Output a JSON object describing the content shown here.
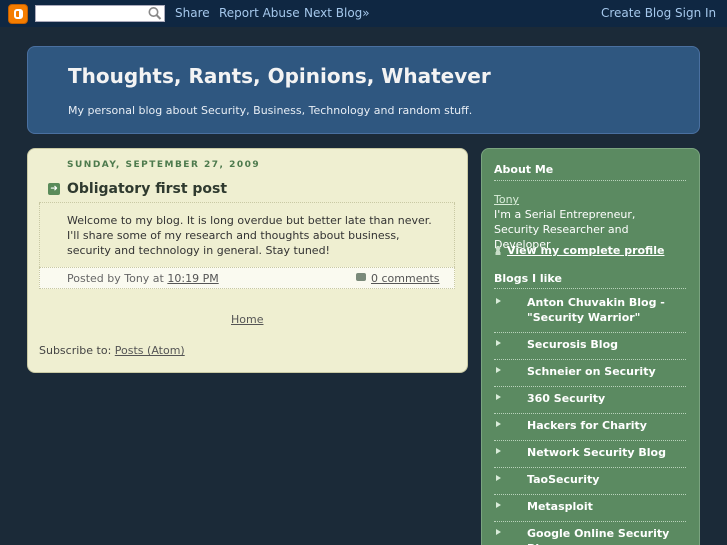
{
  "navbar": {
    "share": "Share",
    "report_abuse": "Report Abuse",
    "next_blog": "Next Blog»",
    "create_blog": "Create Blog",
    "sign_in": "Sign In",
    "search_placeholder": ""
  },
  "header": {
    "title": "Thoughts, Rants, Opinions, Whatever",
    "description": "My personal blog about Security, Business, Technology and random stuff."
  },
  "post": {
    "date": "SUNDAY, SEPTEMBER 27, 2009",
    "title": "Obligatory first post",
    "body": "Welcome to my blog. It is long overdue but better late than never. I'll share some of my research and thoughts about business, security and technology in general. Stay tuned!",
    "posted_by": "Posted by Tony at",
    "time": "10:19 PM",
    "comments": "0 comments"
  },
  "footer": {
    "home": "Home",
    "subscribe_prefix": "Subscribe to:",
    "subscribe_link": "Posts (Atom)"
  },
  "sidebar": {
    "about_title": "About Me",
    "about_name": "Tony",
    "about_text": "I'm a Serial Entrepreneur, Security Researcher and Developer",
    "profile_link": "View my complete profile",
    "blogs_title": "Blogs I like",
    "blogs": [
      "Anton Chuvakin Blog - \"Security Warrior\"",
      "Securosis Blog",
      "Schneier on Security",
      "360 Security",
      "Hackers for Charity",
      "Network Security Blog",
      "TaoSecurity",
      "Metasploit",
      "Google Online Security Blog"
    ]
  },
  "colors": {
    "navbar": "#0f2742",
    "header": "#2f5780",
    "main": "#efefd1",
    "sidebar": "#5b8a61",
    "page": "#1b2a38"
  }
}
